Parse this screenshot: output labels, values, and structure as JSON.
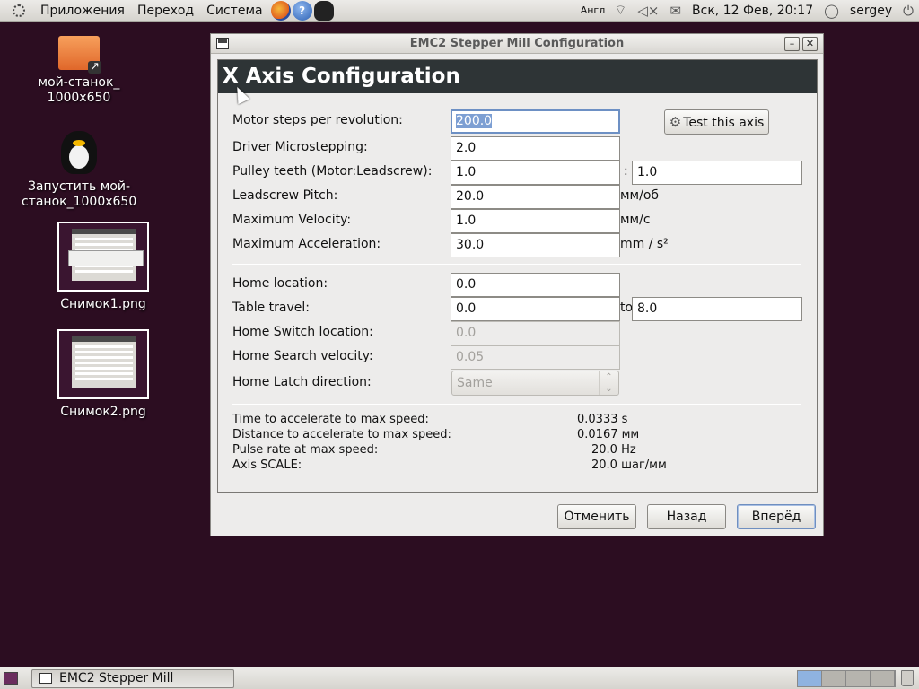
{
  "top_panel": {
    "menus": [
      "Приложения",
      "Переход",
      "Система"
    ],
    "keyboard_layout": "Англ",
    "datetime": "Вск, 12 Фев, 20:17",
    "user": "sergey"
  },
  "desktop": {
    "icons": [
      {
        "label": "мой-станок_ 1000x650",
        "icon": "folder-link-icon"
      },
      {
        "label": "Запустить мой-станок_1000x650",
        "icon": "tux-launcher-icon"
      },
      {
        "label": "Снимок1.png",
        "icon": "image-thumbnail"
      },
      {
        "label": "Снимок2.png",
        "icon": "image-thumbnail"
      }
    ]
  },
  "dialog": {
    "title": "EMC2 Stepper Mill Configuration",
    "header": "X Axis Configuration",
    "fields": {
      "motor_steps": {
        "label": "Motor steps per revolution:",
        "value": "200.0"
      },
      "microstepping": {
        "label": "Driver Microstepping:",
        "value": "2.0"
      },
      "pulley": {
        "label": "Pulley teeth (Motor:Leadscrew):",
        "motor": "1.0",
        "sep": ":",
        "leadscrew": "1.0"
      },
      "pitch": {
        "label": "Leadscrew Pitch:",
        "value": "20.0",
        "unit": "мм/об"
      },
      "max_velocity": {
        "label": "Maximum Velocity:",
        "value": "1.0",
        "unit": "мм/с"
      },
      "max_accel": {
        "label": "Maximum Acceleration:",
        "value": "30.0",
        "unit": "mm / s²"
      },
      "home_location": {
        "label": "Home location:",
        "value": "0.0"
      },
      "table_travel": {
        "label": "Table travel:",
        "from": "0.0",
        "to_label": "to",
        "to": "8.0"
      },
      "home_switch": {
        "label": "Home Switch location:",
        "value": "0.0"
      },
      "home_search": {
        "label": "Home Search velocity:",
        "value": "0.05"
      },
      "home_latch": {
        "label": "Home Latch direction:",
        "value": "Same"
      }
    },
    "test_axis_button": "Test this axis",
    "info": [
      {
        "label": "Time to accelerate to max speed:",
        "value": "0.0333 s"
      },
      {
        "label": "Distance to accelerate to max speed:",
        "value": "0.0167 мм"
      },
      {
        "label": "Pulse rate at max speed:",
        "value": "20.0 Hz"
      },
      {
        "label": "Axis SCALE:",
        "value": "20.0 шаг/мм"
      }
    ],
    "buttons": {
      "cancel": "Отменить",
      "back": "Назад",
      "forward": "Вперёд"
    }
  },
  "taskbar": {
    "task": "EMC2 Stepper Mill Configu..."
  }
}
